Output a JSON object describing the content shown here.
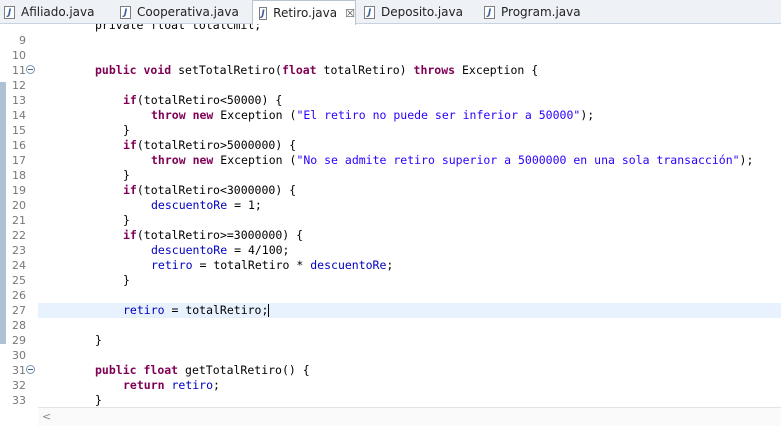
{
  "tabs": [
    {
      "label": "Afiliado.java",
      "active": false
    },
    {
      "label": "Cooperativa.java",
      "active": false
    },
    {
      "label": "Retiro.java",
      "active": true,
      "close": "☒"
    },
    {
      "label": "Deposito.java",
      "active": false
    },
    {
      "label": "Program.java",
      "active": false
    }
  ],
  "editor": {
    "partial_line": "private float totalCmil;",
    "lines": [
      {
        "n": "9",
        "text": ""
      },
      {
        "n": "10",
        "text": ""
      },
      {
        "n": "11",
        "text": "public void setTotalRetiro(float totalRetiro) throws Exception {"
      },
      {
        "n": "12",
        "text": ""
      },
      {
        "n": "13",
        "text": "if(totalRetiro<50000) {"
      },
      {
        "n": "14",
        "text": "throw new Exception (\"El retiro no puede ser inferior a 50000\");"
      },
      {
        "n": "15",
        "text": "}"
      },
      {
        "n": "16",
        "text": "if(totalRetiro>5000000) {"
      },
      {
        "n": "17",
        "text": "throw new Exception (\"No se admite retiro superior a 5000000 en una sola transacción\");"
      },
      {
        "n": "18",
        "text": "}"
      },
      {
        "n": "19",
        "text": "if(totalRetiro<3000000) {"
      },
      {
        "n": "20",
        "text": "descuentoRe = 1;"
      },
      {
        "n": "21",
        "text": "}"
      },
      {
        "n": "22",
        "text": "if(totalRetiro>=3000000) {"
      },
      {
        "n": "23",
        "text": "descuentoRe = 4/100;"
      },
      {
        "n": "24",
        "text": "retiro = totalRetiro * descuentoRe;"
      },
      {
        "n": "25",
        "text": "}"
      },
      {
        "n": "26",
        "text": ""
      },
      {
        "n": "27",
        "text": "retiro = totalRetiro;"
      },
      {
        "n": "28",
        "text": ""
      },
      {
        "n": "29",
        "text": "}"
      },
      {
        "n": "30",
        "text": ""
      },
      {
        "n": "31",
        "text": "public float getTotalRetiro() {"
      },
      {
        "n": "32",
        "text": "return retiro;"
      },
      {
        "n": "33",
        "text": "}"
      }
    ]
  },
  "colors": {
    "keyword": "#7f0055",
    "string": "#2a00ff",
    "field": "#0000c0",
    "current_line": "#e8f2fe"
  }
}
